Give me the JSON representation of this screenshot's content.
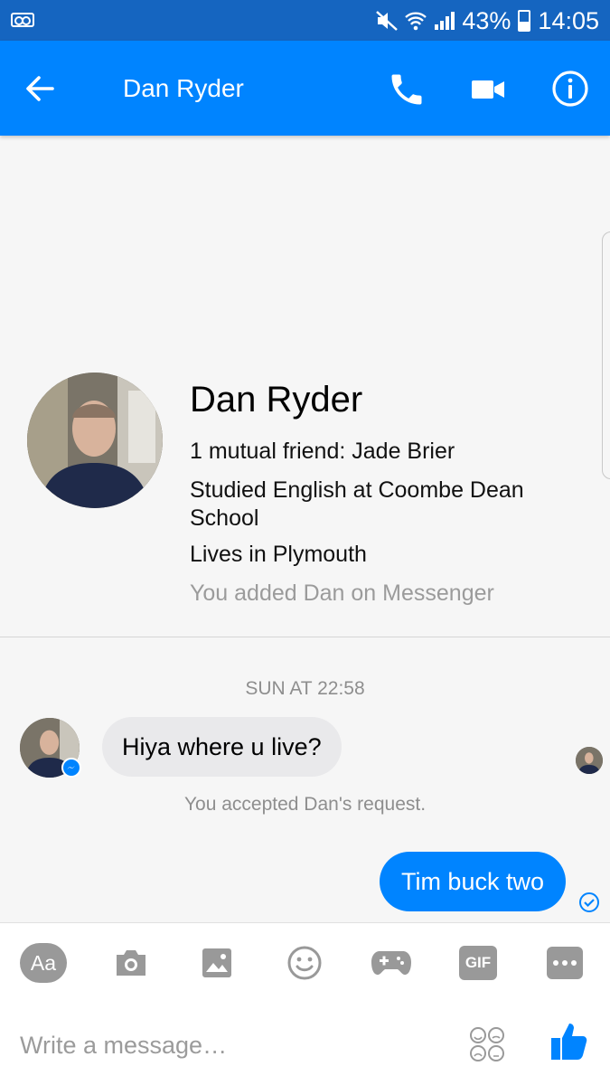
{
  "status_bar": {
    "battery_percent_label": "43%",
    "battery_level": 0.43,
    "time": "14:05",
    "icons": [
      "voicemail-icon",
      "mute-icon",
      "wifi-icon",
      "signal-icon",
      "battery-icon"
    ]
  },
  "header": {
    "title": "Dan Ryder",
    "actions": [
      "back-arrow-icon",
      "phone-icon",
      "video-camera-icon",
      "info-icon"
    ]
  },
  "profile": {
    "name": "Dan Ryder",
    "mutual": "1 mutual friend: Jade Brier",
    "education": "Studied English at Coombe Dean School",
    "location": "Lives in Plymouth",
    "added_note": "You added Dan on Messenger"
  },
  "conversation": {
    "timestamp": "SUN AT 22:58",
    "incoming_message": "Hiya where u live?",
    "system_note": "You accepted Dan's request.",
    "outgoing_message": "Tim buck two"
  },
  "composer": {
    "tools": [
      "text-style",
      "camera-icon",
      "gallery-icon",
      "emoji-icon",
      "games-icon",
      "gif",
      "more-icon"
    ],
    "aa_label": "Aa",
    "gif_label": "GIF",
    "placeholder": "Write a message…",
    "colors": {
      "accent": "#0084ff",
      "status_bar": "#1565c0",
      "tool_grey": "#999999"
    }
  }
}
